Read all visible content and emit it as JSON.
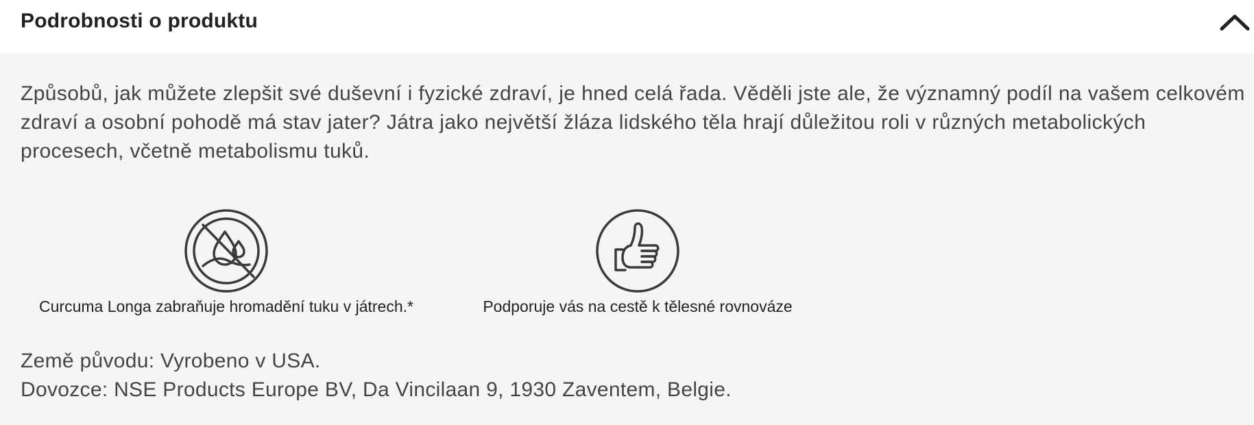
{
  "accordion": {
    "title": "Podrobnosti o produktu",
    "expanded": true,
    "toggle_icon": "chevron-up-icon"
  },
  "description": {
    "paragraph": "Způsobů, jak můžete zlepšit své duševní i fyzické zdraví, je hned celá řada. Věděli jste ale, že významný podíl na vašem celkovém zdraví a osobní pohodě má stav jater? Játra jako největší žláza lidského těla hrají důležitou roli v různých metabolických procesech, včetně metabolismu tuků."
  },
  "features": [
    {
      "icon": "no-fat-drops-icon",
      "caption": "Curcuma Longa zabraňuje hromadění tuku v játrech.*"
    },
    {
      "icon": "thumbs-up-icon",
      "caption": "Podporuje vás na cestě k tělesné rovnováze"
    }
  ],
  "origin": {
    "country": "Země původu: Vyrobeno v USA.",
    "importer": "Dovozce: NSE Products Europe BV, Da Vincilaan 9, 1930 Zaventem, Belgie."
  },
  "colors": {
    "header_bg": "#ffffff",
    "content_bg": "#f4f6f5",
    "text": "#444444",
    "title": "#222222",
    "icon_stroke": "#3a3a3a"
  }
}
